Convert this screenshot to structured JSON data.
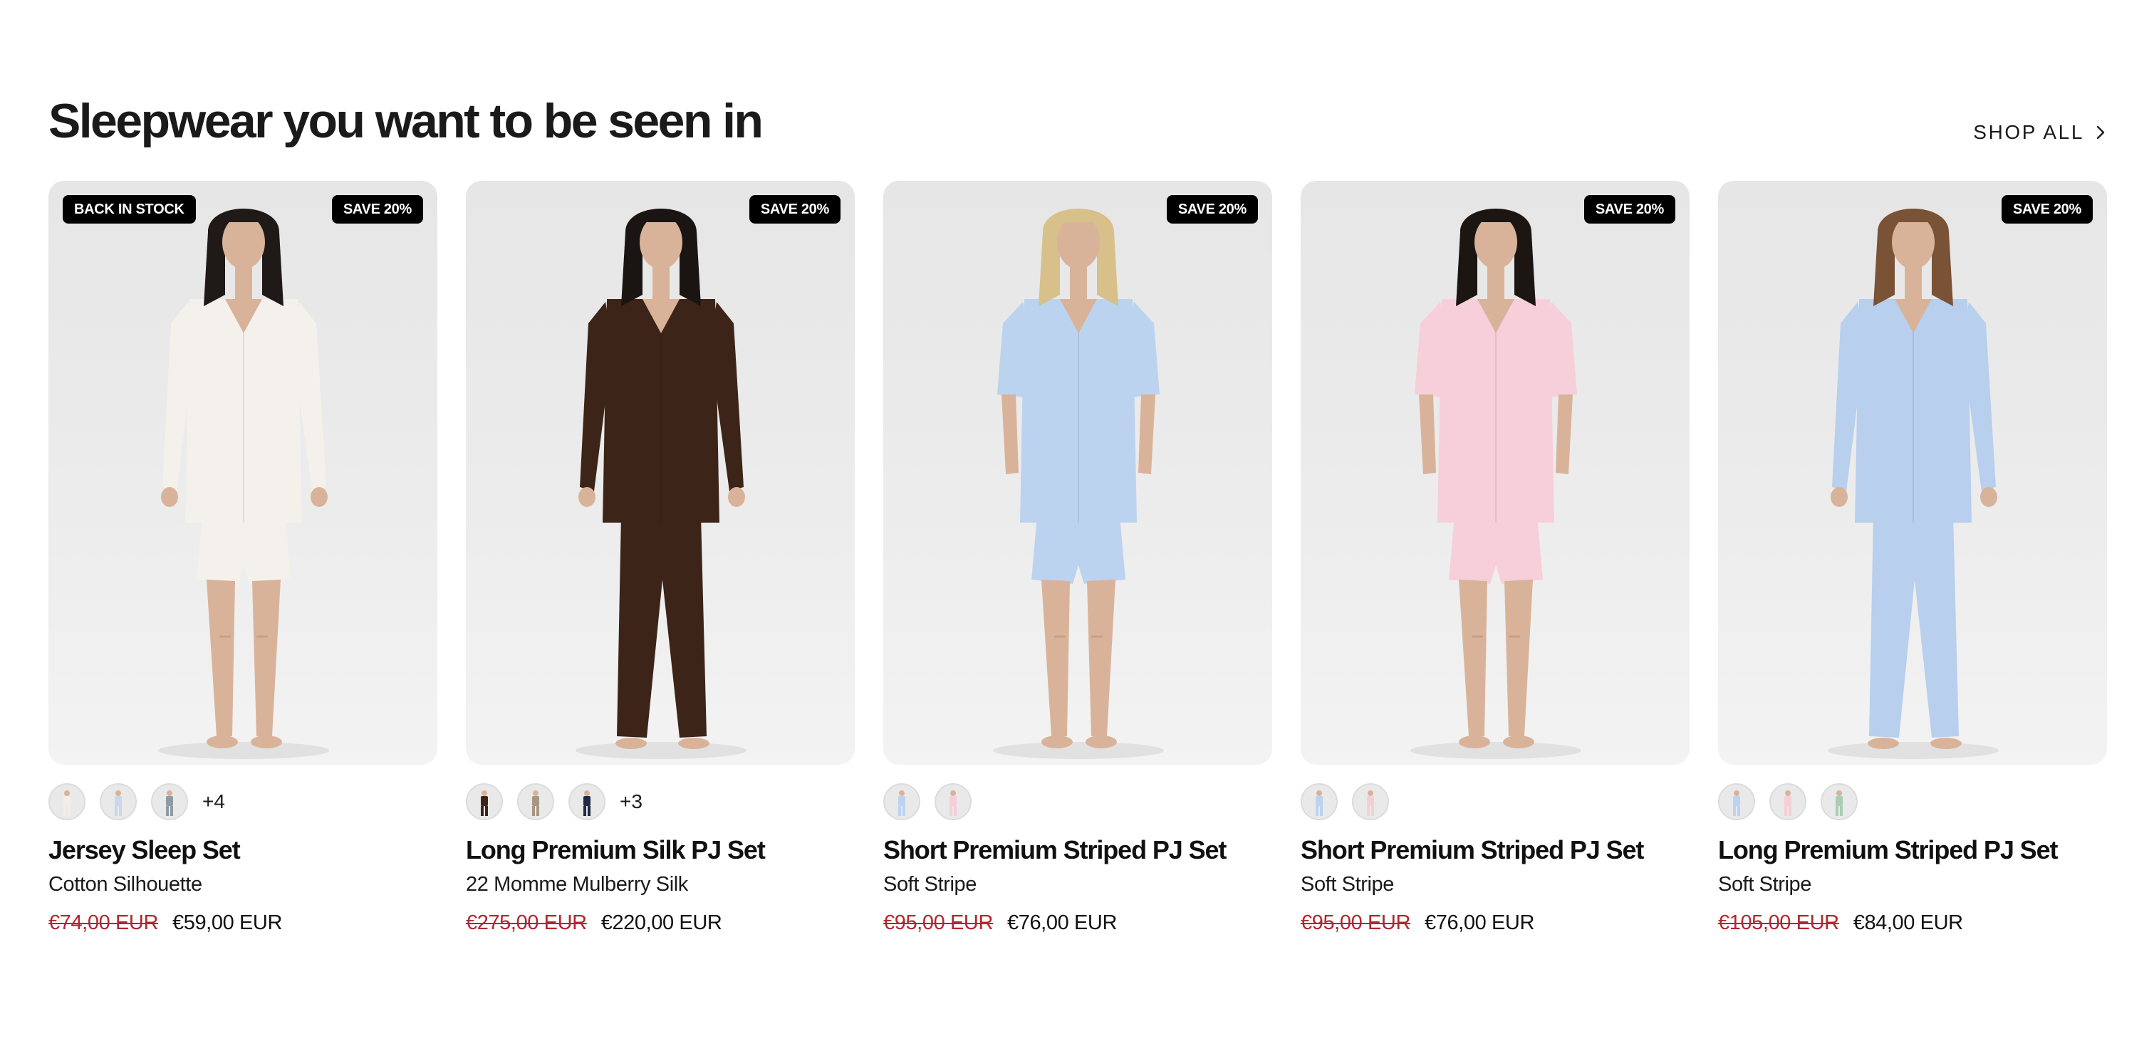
{
  "section": {
    "heading": "Sleepwear you want to be seen in",
    "shop_all": "SHOP ALL"
  },
  "products": [
    {
      "badge_left": "BACK IN STOCK",
      "badge_right": "SAVE 20%",
      "title": "Jersey Sleep Set",
      "subtitle": "Cotton Silhouette",
      "price_old": "€74,00 EUR",
      "price_new": "€59,00 EUR",
      "more_swatches": "+4",
      "top_color": "#f4f1ec",
      "bottom_color": "#f4f1ec",
      "hair_color": "#1f1a17",
      "swatch_colors": [
        "#f1ede7",
        "#c9d8ea",
        "#8f9aa3"
      ]
    },
    {
      "badge_left": "",
      "badge_right": "SAVE 20%",
      "title": "Long Premium Silk PJ Set",
      "subtitle": "22 Momme Mulberry Silk",
      "price_old": "€275,00 EUR",
      "price_new": "€220,00 EUR",
      "more_swatches": "+3",
      "top_color": "#3c2418",
      "bottom_color": "#3c2418",
      "hair_color": "#1a1512",
      "swatch_colors": [
        "#3c2418",
        "#a89682",
        "#1f2a44"
      ]
    },
    {
      "badge_left": "",
      "badge_right": "SAVE 20%",
      "title": "Short Premium Striped PJ Set",
      "subtitle": "Soft Stripe",
      "price_old": "€95,00 EUR",
      "price_new": "€76,00 EUR",
      "more_swatches": "",
      "top_color": "#bcd3f0",
      "bottom_color": "#bcd3f0",
      "hair_color": "#d8c08a",
      "swatch_colors": [
        "#bcd3f0",
        "#f5cfd8"
      ]
    },
    {
      "badge_left": "",
      "badge_right": "SAVE 20%",
      "title": "Short Premium Striped PJ Set",
      "subtitle": "Soft Stripe",
      "price_old": "€95,00 EUR",
      "price_new": "€76,00 EUR",
      "more_swatches": "",
      "top_color": "#f6cfda",
      "bottom_color": "#f6cfda",
      "hair_color": "#1c1613",
      "swatch_colors": [
        "#bcd3f0",
        "#f5cfd8"
      ]
    },
    {
      "badge_left": "",
      "badge_right": "SAVE 20%",
      "title": "Long Premium Striped PJ Set",
      "subtitle": "Soft Stripe",
      "price_old": "€105,00 EUR",
      "price_new": "€84,00 EUR",
      "more_swatches": "",
      "top_color": "#b8cfee",
      "bottom_color": "#b8cfee",
      "hair_color": "#7a5236",
      "swatch_colors": [
        "#bcd3f0",
        "#f5cfd8",
        "#a9cdb4"
      ]
    }
  ],
  "colors": {
    "sale_price": "#b3262d",
    "badge_bg": "#000000",
    "card_bg": "#e9e9e9"
  },
  "icons": {
    "shop_all": "chevron-right-icon",
    "product_photo": "model-photo-icon",
    "swatch": "color-swatch-icon"
  }
}
